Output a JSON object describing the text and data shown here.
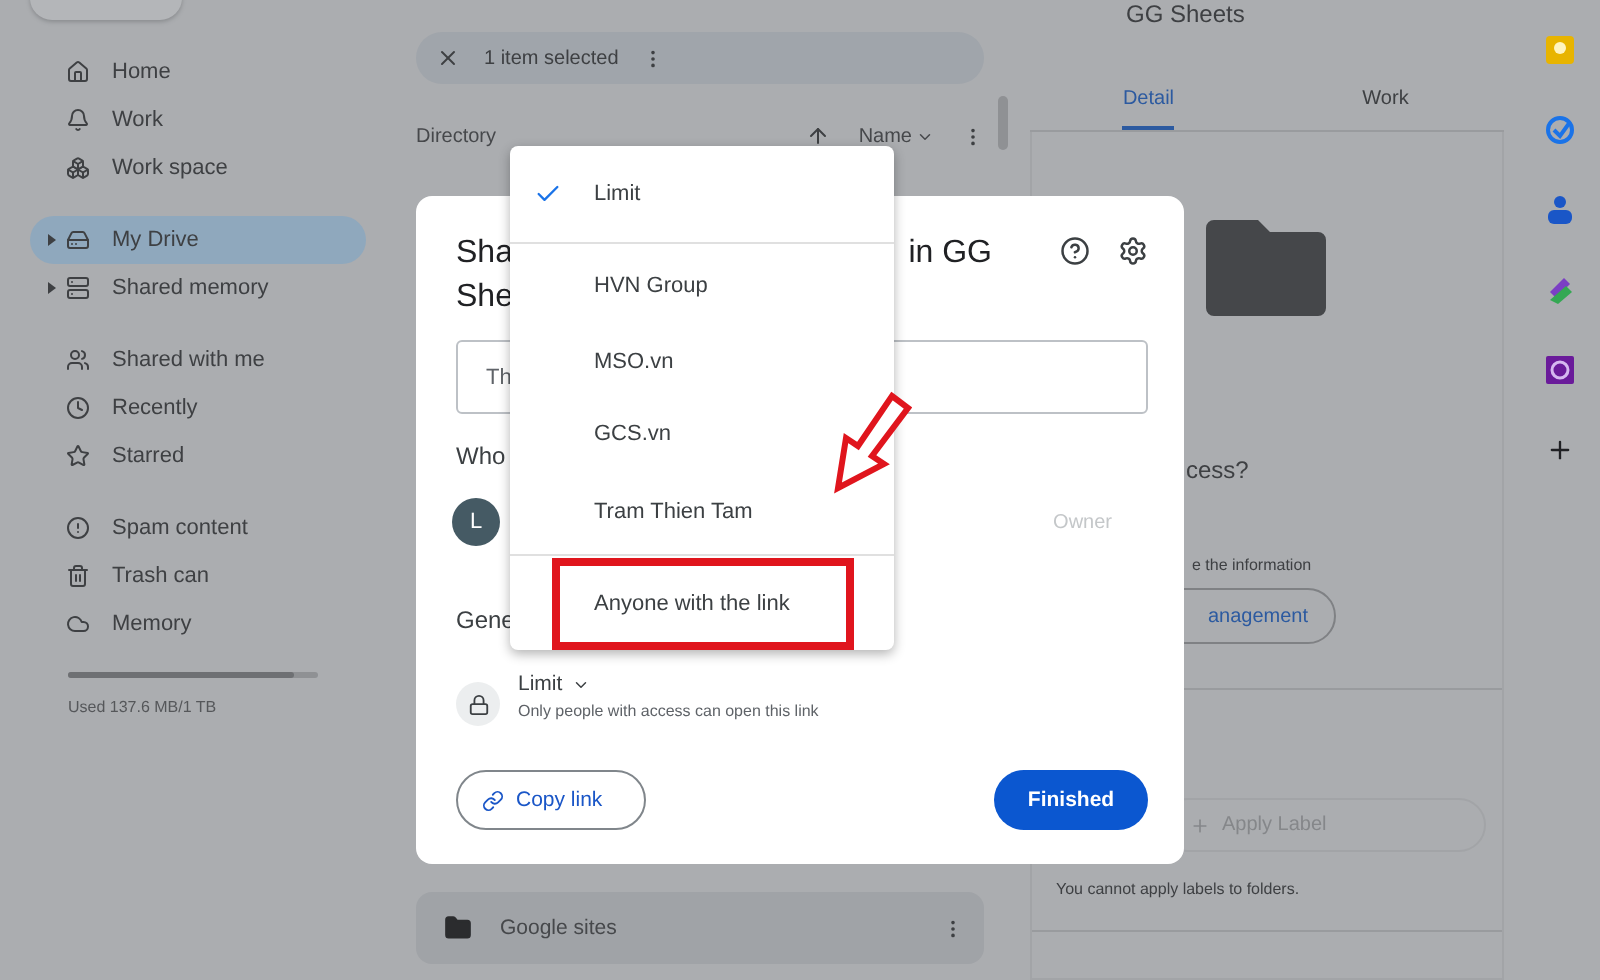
{
  "sidebar": {
    "groups": [
      [
        {
          "label": "Home",
          "selected": false,
          "expandable": false
        },
        {
          "label": "Work",
          "selected": false,
          "expandable": false
        },
        {
          "label": "Work space",
          "selected": false,
          "expandable": false
        }
      ],
      [
        {
          "label": "My Drive",
          "selected": true,
          "expandable": true
        },
        {
          "label": "Shared memory",
          "selected": false,
          "expandable": true
        }
      ],
      [
        {
          "label": "Shared with me",
          "selected": false,
          "expandable": false
        },
        {
          "label": "Recently",
          "selected": false,
          "expandable": false
        },
        {
          "label": "Starred",
          "selected": false,
          "expandable": false
        }
      ],
      [
        {
          "label": "Spam content",
          "selected": false,
          "expandable": false
        },
        {
          "label": "Trash can",
          "selected": false,
          "expandable": false
        },
        {
          "label": "Memory",
          "selected": false,
          "expandable": false
        }
      ]
    ],
    "storage": {
      "level": 0.9,
      "text": "Used 137.6 MB/1 TB"
    }
  },
  "selection_bar": {
    "text": "1 item selected"
  },
  "list_header": {
    "title": "Directory",
    "sort": "Name"
  },
  "rows": [
    {
      "name": "Google sites"
    }
  ],
  "details": {
    "title": "GG Sheets",
    "tabs": [
      {
        "label": "Detail",
        "selected": true
      },
      {
        "label": "Work",
        "selected": false
      }
    ],
    "access_heading": "cess?",
    "access_note": "e the information",
    "manage_button": "anagement",
    "label_placeholder": "Apply Label",
    "label_note": "You cannot apply labels to folders."
  },
  "dialog": {
    "title_start": "Sha",
    "title_end": "in GG",
    "title_line2": "She",
    "field_placeholder": "Th",
    "people_heading": "Who",
    "person": {
      "initial": "L",
      "role": "Owner"
    },
    "general_heading": "Gene",
    "access": {
      "value": "Limit",
      "description": "Only people with access can open this link"
    },
    "copy_button": "Copy link",
    "done_button": "Finished"
  },
  "access_menu": {
    "options": [
      {
        "label": "Limit",
        "selected": true,
        "highlighted": false
      },
      {
        "label": "HVN Group",
        "selected": false,
        "highlighted": false
      },
      {
        "label": "MSO.vn",
        "selected": false,
        "highlighted": false
      },
      {
        "label": "GCS.vn",
        "selected": false,
        "highlighted": false
      },
      {
        "label": "Tram Thien Tam",
        "selected": false,
        "highlighted": false
      },
      {
        "label": "Anyone with the link",
        "selected": false,
        "highlighted": true
      }
    ]
  }
}
